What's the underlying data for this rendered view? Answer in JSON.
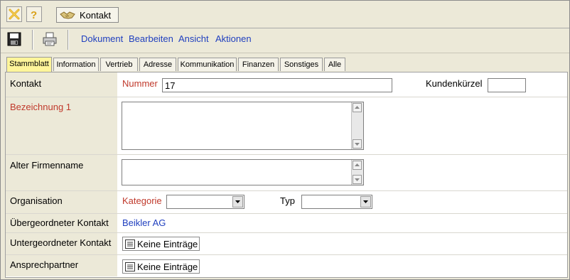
{
  "window": {
    "title_button": "Kontakt"
  },
  "menu": [
    "Dokument",
    "Bearbeiten",
    "Ansicht",
    "Aktionen"
  ],
  "tabs": [
    "Stammblatt",
    "Information",
    "Vertrieb",
    "Adresse",
    "Kommunikation",
    "Finanzen",
    "Sonstiges",
    "Alle"
  ],
  "active_tab": "Stammblatt",
  "form": {
    "kontakt_label": "Kontakt",
    "nummer_label": "Nummer",
    "nummer_value": "17",
    "kuerzel_label": "Kundenkürzel",
    "kuerzel_value": "",
    "bezeichnung_label": "Bezeichnung 1",
    "bezeichnung_value": "",
    "alter_label": "Alter Firmenname",
    "alter_value": "",
    "organisation_label": "Organisation",
    "kategorie_label": "Kategorie",
    "kategorie_value": "",
    "typ_label": "Typ",
    "typ_value": "",
    "uebergeordnet_label": "Übergeordneter Kontakt",
    "uebergeordnet_value": "Beikler AG",
    "untergeordnet_label": "Untergeordneter Kontakt",
    "untergeordnet_button": "Keine Einträge",
    "ansprech_label": "Ansprechpartner",
    "ansprech_button": "Keine Einträge"
  },
  "colors": {
    "required_label": "#c0392b",
    "link": "#1f3fbf",
    "active_tab": "#fff59a",
    "background": "#ece9d8"
  },
  "icons": [
    "close-icon",
    "help-icon",
    "handshake-icon",
    "save-icon",
    "print-icon",
    "list-icon"
  ]
}
